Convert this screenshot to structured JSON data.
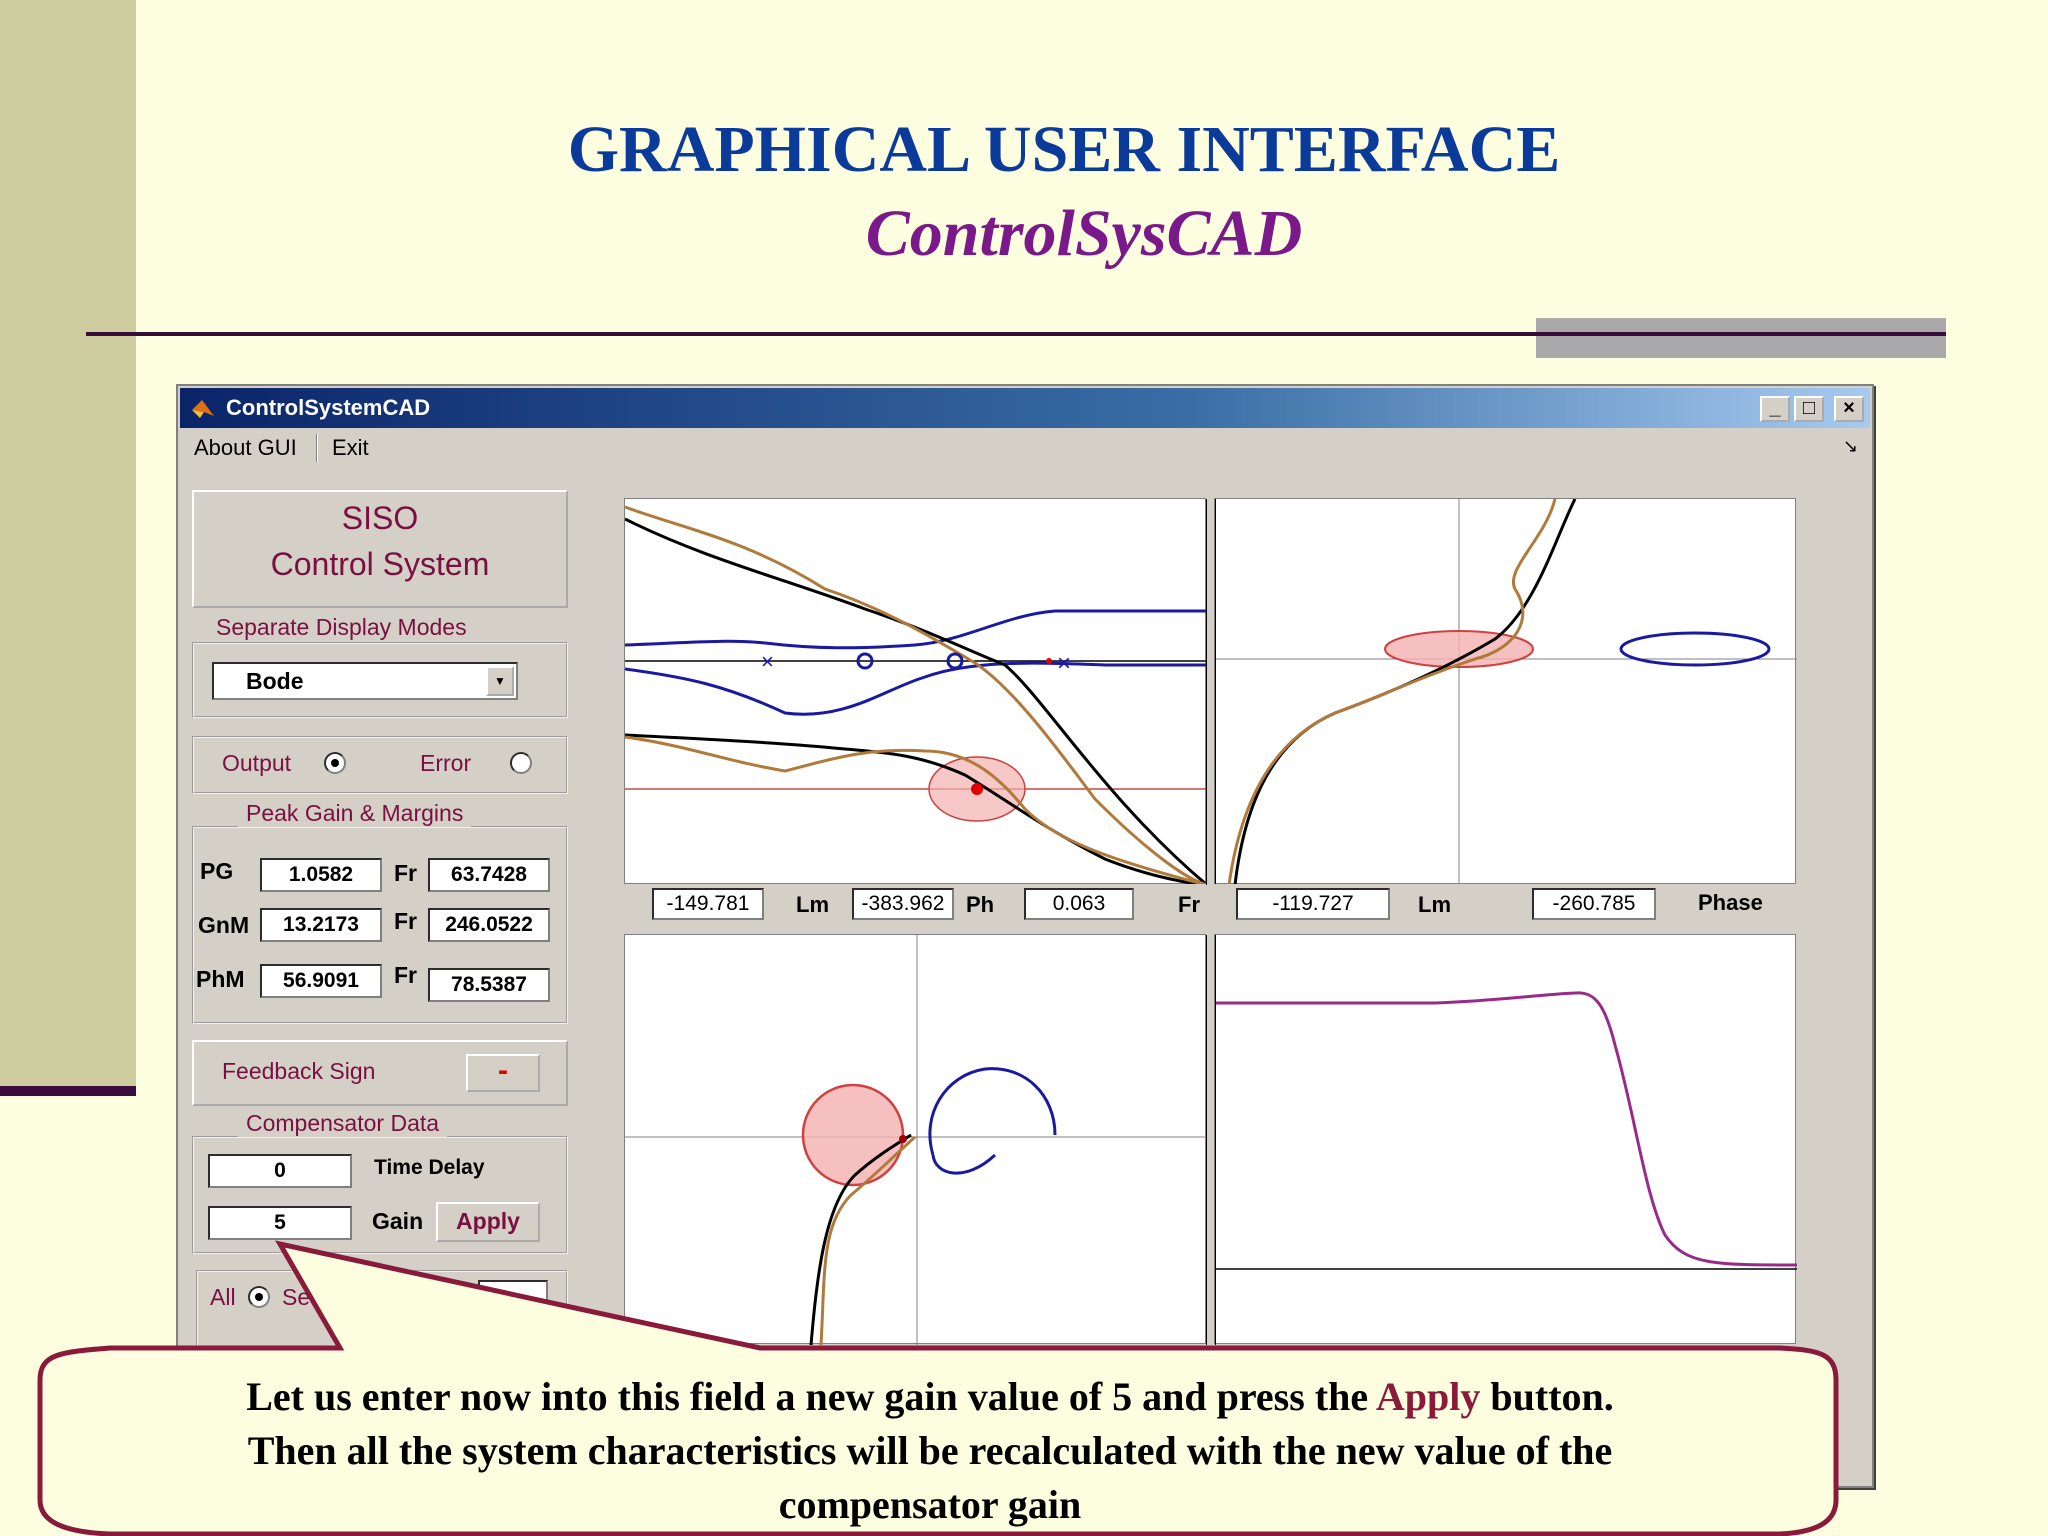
{
  "slide": {
    "title": "GRAPHICAL USER INTERFACE",
    "subtitle": "ControlSysCAD"
  },
  "window": {
    "title": "ControlSystemCAD",
    "minimize": "_",
    "maximize": "□",
    "close": "×"
  },
  "menu": {
    "about": "About GUI",
    "exit": "Exit"
  },
  "panel": {
    "header_line1": "SISO",
    "header_line2": "Control System",
    "display_modes_title": "Separate Display Modes",
    "display_mode_selected": "Bode",
    "output_label": "Output",
    "error_label": "Error",
    "margins_title": "Peak Gain & Margins",
    "rows": [
      {
        "label": "PG",
        "value": "1.0582",
        "fr_label": "Fr",
        "fr_value": "63.7428"
      },
      {
        "label": "GnM",
        "value": "13.2173",
        "fr_label": "Fr",
        "fr_value": "246.0522"
      },
      {
        "label": "PhM",
        "value": "56.9091",
        "fr_label": "Fr",
        "fr_value": "78.5387"
      }
    ],
    "feedback_label": "Feedback  Sign",
    "feedback_value": "-",
    "comp_title": "Compensator Data",
    "time_delay_value": "0",
    "time_delay_label": "Time Delay",
    "gain_value": "5",
    "gain_label": "Gain",
    "apply_label": "Apply",
    "all_label": "All",
    "sel_label": "Se"
  },
  "bode_readout": {
    "v1": "-149.781",
    "l1": "Lm",
    "v2": "-383.962",
    "l2": "Ph",
    "v3": "0.063",
    "l3": "Fr"
  },
  "nichols_readout": {
    "v1": "-119.727",
    "l1": "Lm",
    "v2": "-260.785",
    "l2": "Phase"
  },
  "callout": {
    "line1_pre": "Let us enter now into this field a new gain value of 5 and press the ",
    "line1_apply": "Apply",
    "line1_post": " button.",
    "line2": "Then all the system characteristics will be recalculated with  the new value of the",
    "line3": "compensator gain"
  },
  "colors": {
    "title_blue": "#0a3a9a",
    "subtitle_purple": "#7a1a8a",
    "panel_text": "#7a1040",
    "callout_border": "#8a1a3a"
  }
}
